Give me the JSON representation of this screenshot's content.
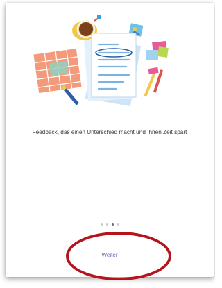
{
  "onboarding": {
    "caption": "Feedback, das einen Unterschied macht und Ihnen Zeit spart",
    "next_label": "Weiter",
    "pagination": {
      "total": 4,
      "active_index": 2
    }
  },
  "illustration_icons": [
    "coffee-cup-icon",
    "spreadsheet-icon",
    "document-stack-icon",
    "pencil-icon",
    "sticky-note-icon",
    "photo-frame-icon"
  ],
  "colors": {
    "accent": "#6264a7",
    "highlight_ring": "#b5141d",
    "caption_text": "#3a3a3a"
  }
}
